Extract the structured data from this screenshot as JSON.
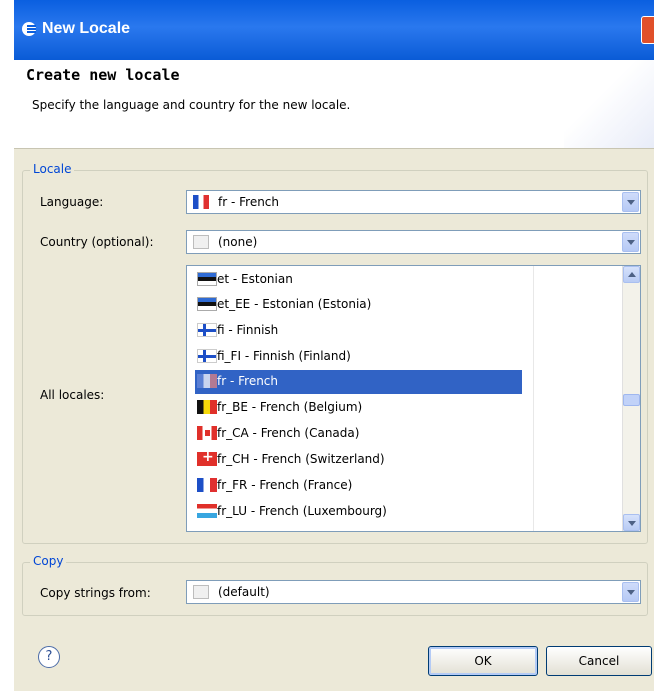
{
  "window": {
    "title": "New Locale"
  },
  "header": {
    "title": "Create new locale",
    "description": "Specify the language and country for the new locale."
  },
  "locale_group": {
    "label": "Locale",
    "language_label": "Language:",
    "language_value": "fr - French",
    "country_label": "Country (optional):",
    "country_value": "(none)",
    "all_locales_label": "All locales:",
    "items": [
      {
        "text": "et - Estonian",
        "flag": "estonia-flag"
      },
      {
        "text": "et_EE - Estonian (Estonia)",
        "flag": "estonia-flag"
      },
      {
        "text": "fi - Finnish",
        "flag": "finland-flag"
      },
      {
        "text": "fi_FI - Finnish (Finland)",
        "flag": "finland-flag"
      },
      {
        "text": "fr - French",
        "flag": "france-flag",
        "selected": true
      },
      {
        "text": "fr_BE - French (Belgium)",
        "flag": "belgium-flag"
      },
      {
        "text": "fr_CA - French (Canada)",
        "flag": "canada-flag"
      },
      {
        "text": "fr_CH - French (Switzerland)",
        "flag": "switzerland-flag"
      },
      {
        "text": "fr_FR - French (France)",
        "flag": "france-flag"
      },
      {
        "text": "fr_LU - French (Luxembourg)",
        "flag": "luxembourg-flag"
      }
    ]
  },
  "copy_group": {
    "label": "Copy",
    "copy_label": "Copy strings from:",
    "copy_value": "(default)"
  },
  "buttons": {
    "ok": "OK",
    "cancel": "Cancel",
    "help": "?"
  }
}
